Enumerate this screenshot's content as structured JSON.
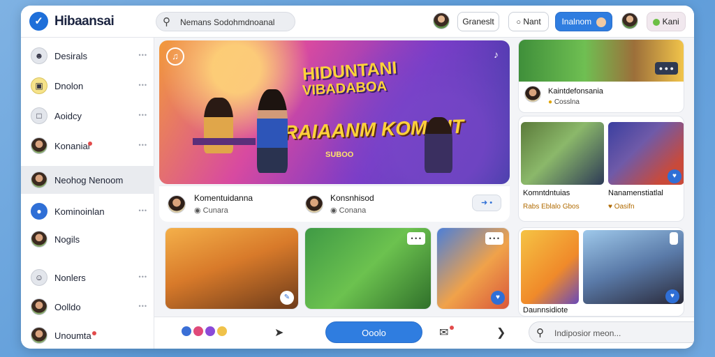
{
  "app": {
    "title": "Hibaansai",
    "logo_icon": "check-icon"
  },
  "header": {
    "search_text": "Nemans Sodohmdnoanal",
    "button_1": "Graneslt",
    "button_2": "Nant",
    "button_3": "Inalnom",
    "button_4": "Kani"
  },
  "sidebar": {
    "items": [
      {
        "label": "Desirals",
        "icon": "user-circle-icon",
        "active": false
      },
      {
        "label": "Dnolon",
        "icon": "box-icon",
        "active": false
      },
      {
        "label": "Aoidcy",
        "icon": "square-icon",
        "active": false
      },
      {
        "label": "Konanial",
        "icon": "avatar-icon",
        "active": false
      },
      {
        "label": "Neohog Nenoom",
        "icon": "avatar-icon",
        "active": true
      },
      {
        "label": "Kominoinlan",
        "icon": "globe-icon",
        "active": false
      },
      {
        "label": "Nogils",
        "icon": "avatar-icon",
        "active": false
      },
      {
        "label": "Nonlers",
        "icon": "person-icon",
        "active": false
      },
      {
        "label": "Oolldo",
        "icon": "avatar-icon",
        "active": false
      },
      {
        "label": "Unoumta",
        "icon": "group-icon",
        "active": false
      }
    ]
  },
  "hero": {
    "headline_1": "HIDUNTANI",
    "headline_2": "VIBADABOA",
    "headline_3": "RAIAANM KOMNIIT",
    "headline_4": "SUBOO",
    "footer": {
      "left_title": "Komentuidanna",
      "left_sub": "Cunara",
      "right_title": "Konsnhisod",
      "right_sub": "Conana"
    }
  },
  "right_top_card": {
    "chip": "● ● ●",
    "title": "Kaintdefonsania",
    "sub": "Cosslna"
  },
  "right_cards": [
    {
      "title": "Komntdntuias",
      "sub": "Rabs Eblalo Gbos"
    },
    {
      "title": "Nanamenstiatlal",
      "sub": "Oasifn"
    }
  ],
  "bottom_grid": {
    "card_1": {
      "chip": ""
    },
    "card_2": {
      "chip": "• • •"
    },
    "card_3": {
      "chip": "• • •"
    },
    "card_4": {
      "title": "Daunnsidiote",
      "chip": ""
    },
    "card_5": {
      "chip": ""
    }
  },
  "bottom_bar": {
    "primary_button": "Ooolo",
    "search_placeholder": "Indiposior meon..."
  }
}
